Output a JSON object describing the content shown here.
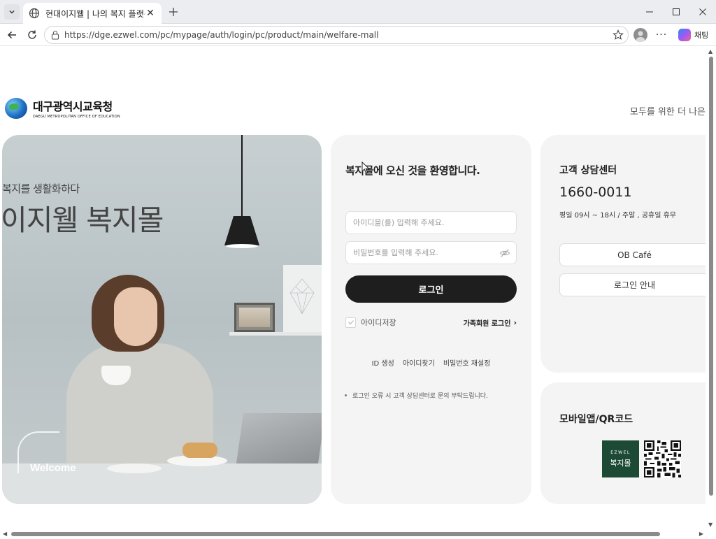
{
  "browser": {
    "tab_title": "현대이지웰 | 나의 복지 플랫폼",
    "url": "https://dge.ezwel.com/pc/mypage/auth/login/pc/product/main/welfare-mall",
    "copilot_label": "채팅"
  },
  "header": {
    "logo_ko": "대구광역시교육청",
    "logo_en": "DAEGU METROPOLITAN OFFICE OF EDUCATION",
    "tagline": "모두를 위한 더 나은"
  },
  "hero": {
    "subtitle": "복지를 생활화하다",
    "title": "이지웰 복지몰",
    "welcome": "Welcome"
  },
  "login": {
    "welcome_message": "복지몰에 오신 것을 환영합니다.",
    "id_placeholder": "아이디을(를) 입력해 주세요.",
    "pw_placeholder": "비밀번호를 입력해 주세요.",
    "login_button": "로그인",
    "save_id_label": "아이디저장",
    "family_login": "가족회원 로그인",
    "links": [
      "ID 생성",
      "아이디찾기",
      "비밀번호 재설정"
    ],
    "notice": "로그인 오류 시 고객 상담센터로 문의 부탁드립니다."
  },
  "customer_center": {
    "title": "고객 상담센터",
    "phone": "1660-0011",
    "hours": "평일 09시 ~ 18시 / 주말 , 공휴일 휴무",
    "ob_cafe": "OB Café",
    "login_guide": "로그인 안내"
  },
  "mobile": {
    "title": "모바일앱/QR코드",
    "app_brand": "EZWEL",
    "app_name": "복지몰"
  },
  "colors": {
    "primary_button": "#1e1e1e",
    "card_bg": "#f4f4f4",
    "app_icon_bg": "#1d4a35"
  }
}
